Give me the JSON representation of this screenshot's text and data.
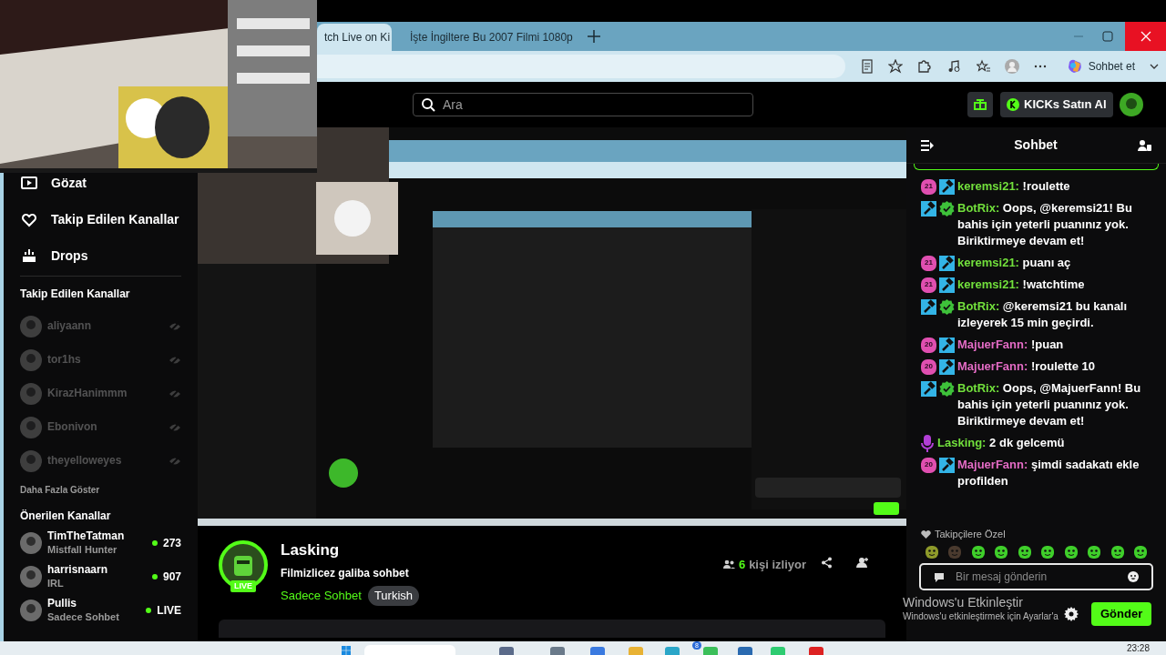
{
  "browser": {
    "tabs": [
      {
        "title": "tch Live on Ki",
        "selected": true
      },
      {
        "title": "İşte İngiltere Bu 2007 Filmi 1080p",
        "selected": false
      }
    ],
    "copilot_label": "Sohbet et"
  },
  "header": {
    "search_placeholder": "Ara",
    "buy_button": "KICKs Satın Al"
  },
  "sidebar": {
    "nav": [
      {
        "label": "Gözat"
      },
      {
        "label": "Takip Edilen Kanallar"
      },
      {
        "label": "Drops"
      }
    ],
    "followed_title": "Takip Edilen Kanallar",
    "followed": [
      {
        "name": "aliyaann",
        "live": false
      },
      {
        "name": "tor1hs",
        "live": false
      },
      {
        "name": "KirazHanimmm",
        "live": false
      },
      {
        "name": "Ebonivon",
        "live": false
      },
      {
        "name": "theyelloweyes",
        "live": false
      }
    ],
    "show_more": "Daha Fazla Göster",
    "recommended_title": "Önerilen Kanallar",
    "recommended": [
      {
        "name": "TimTheTatman",
        "category": "Mistfall Hunter",
        "live": true,
        "viewers": "273"
      },
      {
        "name": "harrisnaarn",
        "category": "IRL",
        "live": true,
        "viewers": "907"
      },
      {
        "name": "Pullis",
        "category": "Sadece Sohbet",
        "live": true,
        "viewers": "LIVE"
      }
    ]
  },
  "stream": {
    "name": "Lasking",
    "live_badge": "LIVE",
    "title": "Filmizlicez galiba sohbet",
    "category": "Sadece Sohbet",
    "tags": [
      "Turkish"
    ],
    "viewer_count": "6",
    "viewer_label": "kişi izliyor"
  },
  "chat": {
    "title": "Sohbet",
    "messages": [
      {
        "badges": [
          {
            "kind": "subscriber",
            "label": "21"
          },
          {
            "kind": "moderator"
          }
        ],
        "user": "keremsi21:",
        "color": "#72e03c",
        "text": "!roulette"
      },
      {
        "badges": [
          {
            "kind": "moderator"
          },
          {
            "kind": "verified"
          }
        ],
        "user": "BotRix:",
        "color": "#72e03c",
        "text": "Oops, @keremsi21! Bu bahis için yeterli puanınız yok. Biriktirmeye devam et!"
      },
      {
        "badges": [
          {
            "kind": "subscriber",
            "label": "21"
          },
          {
            "kind": "moderator"
          }
        ],
        "user": "keremsi21:",
        "color": "#72e03c",
        "text": "puanı aç"
      },
      {
        "badges": [
          {
            "kind": "subscriber",
            "label": "21"
          },
          {
            "kind": "moderator"
          }
        ],
        "user": "keremsi21:",
        "color": "#72e03c",
        "text": "!watchtime"
      },
      {
        "badges": [
          {
            "kind": "moderator"
          },
          {
            "kind": "verified"
          }
        ],
        "user": "BotRix:",
        "color": "#72e03c",
        "text": "@keremsi21 bu kanalı izleyerek 15 min geçirdi."
      },
      {
        "badges": [
          {
            "kind": "subscriber",
            "label": "20"
          },
          {
            "kind": "moderator"
          }
        ],
        "user": "MajuerFann:",
        "color": "#e36bc4",
        "text": "!puan"
      },
      {
        "badges": [
          {
            "kind": "subscriber",
            "label": "20"
          },
          {
            "kind": "moderator"
          }
        ],
        "user": "MajuerFann:",
        "color": "#e36bc4",
        "text": "!roulette 10"
      },
      {
        "badges": [
          {
            "kind": "moderator"
          },
          {
            "kind": "verified"
          }
        ],
        "user": "BotRix:",
        "color": "#72e03c",
        "text": "Oops, @MajuerFann! Bu bahis için yeterli puanınız yok. Biriktirmeye devam et!"
      },
      {
        "badges": [
          {
            "kind": "broadcaster"
          }
        ],
        "user": "Lasking:",
        "color": "#72e03c",
        "text": "2 dk gelcemü"
      },
      {
        "badges": [
          {
            "kind": "subscriber",
            "label": "20"
          },
          {
            "kind": "moderator"
          }
        ],
        "user": "MajuerFann:",
        "color": "#e36bc4",
        "text": "şimdi sadakatı ekle profilden"
      }
    ],
    "emote_section": "Takipçilere Özel",
    "input_placeholder": "Bir mesaj gönderin",
    "send_button": "Gönder"
  },
  "windows_notice": {
    "title": "Windows'u Etkinleştir",
    "text": "Windows'u etkinleştirmek için Ayarlar'a"
  },
  "taskbar": {
    "time": "23:28",
    "notification_count": "8"
  }
}
